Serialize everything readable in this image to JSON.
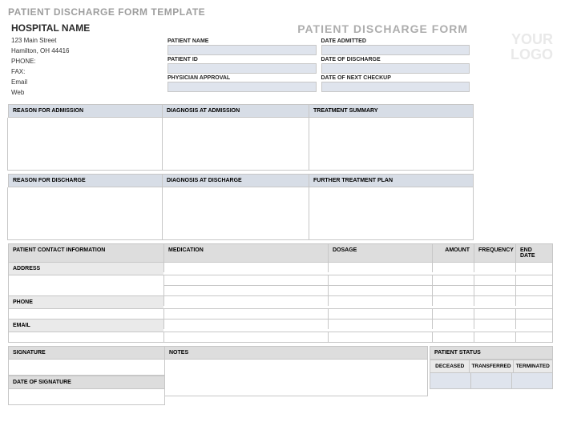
{
  "template_title": "PATIENT DISCHARGE FORM TEMPLATE",
  "hospital": {
    "name": "HOSPITAL NAME",
    "address1": "123 Main Street",
    "address2": "Hamilton, OH 44416",
    "phone_label": "PHONE:",
    "fax_label": "FAX:",
    "email_label": "Email",
    "web_label": "Web"
  },
  "form_title": "PATIENT DISCHARGE FORM",
  "logo_text": "YOUR LOGO",
  "patient_fields": {
    "name": "PATIENT NAME",
    "date_admitted": "DATE ADMITTED",
    "id": "PATIENT ID",
    "date_discharge": "DATE OF DISCHARGE",
    "physician": "PHYSICIAN APPROVAL",
    "next_checkup": "DATE OF NEXT CHECKUP"
  },
  "section_admission": {
    "reason": "REASON FOR ADMISSION",
    "diagnosis": "DIAGNOSIS AT ADMISSION",
    "treatment": "TREATMENT SUMMARY"
  },
  "section_discharge": {
    "reason": "REASON FOR DISCHARGE",
    "diagnosis": "DIAGNOSIS AT DISCHARGE",
    "further": "FURTHER TREATMENT PLAN"
  },
  "contact": {
    "header": "PATIENT CONTACT INFORMATION",
    "address": "ADDRESS",
    "phone": "PHONE",
    "email": "EMAIL"
  },
  "med_headers": {
    "medication": "MEDICATION",
    "dosage": "DOSAGE",
    "amount": "AMOUNT",
    "frequency": "FREQUENCY",
    "end_date": "END DATE"
  },
  "signature": {
    "sig": "SIGNATURE",
    "date": "DATE OF SIGNATURE",
    "notes": "NOTES"
  },
  "status": {
    "header": "PATIENT STATUS",
    "deceased": "DECEASED",
    "transferred": "TRANSFERRED",
    "terminated": "TERMINATED"
  }
}
